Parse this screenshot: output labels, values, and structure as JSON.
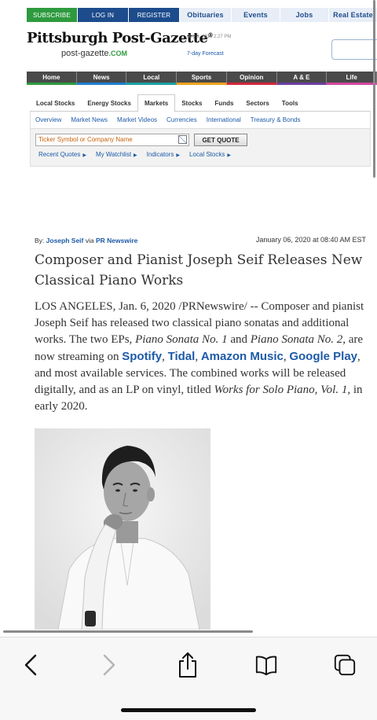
{
  "topbar": {
    "subscribe": "SUBSCRIBE",
    "login": "LOG IN",
    "register": "REGISTER",
    "links": [
      "Obituaries",
      "Events",
      "Jobs",
      "Real Estate"
    ]
  },
  "masthead": {
    "logo": "Pittsburgh Post-Gazette",
    "logo_mark": "®",
    "site": "post-gazette",
    "site_tld": ".COM",
    "datestamp": "July 5, 2018 2:27 PM",
    "forecast": "7-day Forecast"
  },
  "mainnav": [
    "Home",
    "News",
    "Local",
    "Sports",
    "Opinion",
    "A & E",
    "Life"
  ],
  "mainnav_colors": [
    "#2e9a3e",
    "#1d7fd1",
    "#1aa0a0",
    "#f0a11a",
    "#d1253a",
    "#6a3fa0",
    "#d1479c"
  ],
  "markets": {
    "tabs": [
      "Local Stocks",
      "Energy Stocks",
      "Markets",
      "Stocks",
      "Funds",
      "Sectors",
      "Tools"
    ],
    "active_tab": "Markets",
    "subtabs": [
      "Overview",
      "Market News",
      "Market Videos",
      "Currencies",
      "International",
      "Treasury & Bonds"
    ],
    "ticker_placeholder": "Ticker Symbol or Company Name",
    "get_quote": "GET QUOTE",
    "quick_links": [
      "Recent Quotes",
      "My Watchlist",
      "Indicators",
      "Local Stocks"
    ]
  },
  "article": {
    "by_label": "By:",
    "author": "Joseph Seif",
    "via": "via",
    "source": "PR Newswire",
    "date": "January 06, 2020 at 08:40 AM EST",
    "headline": "Composer and Pianist Joseph Seif Releases New Classical Piano Works",
    "p1_a": "LOS ANGELES, Jan. 6, 2020 /PRNewswire/ -- Composer and pianist Joseph Seif has released two classical piano sonatas and additional works. The two EPs, ",
    "sonata1": "Piano Sonata No. 1",
    "and": " and ",
    "sonata2": "Piano Sonata No. 2",
    "p1_b": ", are now streaming on ",
    "spotify": "Spotify",
    "comma1": ", ",
    "tidal": "Tidal",
    "comma2": ", ",
    "amazon": "Amazon Music",
    "comma3": ", ",
    "google": "Google Play",
    "p1_c": ", and most available services. The combined works will be released digitally, and as an LP on vinyl, titled ",
    "album": "Works for Solo Piano, Vol. 1,",
    "p1_d": " in early 2020."
  },
  "toolbar_icons": [
    "back-icon",
    "forward-icon",
    "share-icon",
    "bookmarks-icon",
    "tabs-icon"
  ]
}
